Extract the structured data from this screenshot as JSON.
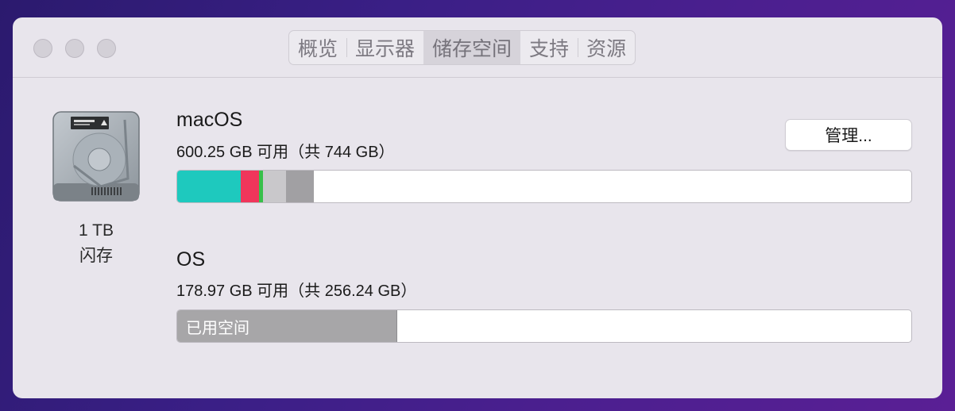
{
  "tabs": [
    {
      "label": "概览",
      "active": false
    },
    {
      "label": "显示器",
      "active": false
    },
    {
      "label": "储存空间",
      "active": true
    },
    {
      "label": "支持",
      "active": false
    },
    {
      "label": "资源",
      "active": false
    }
  ],
  "disk": {
    "icon": "hard-drive-icon",
    "size": "1 TB",
    "type": "闪存"
  },
  "volumes": [
    {
      "name": "macOS",
      "info": "600.25 GB 可用（共 744 GB）",
      "used_fraction": 0.193,
      "segments": [
        {
          "color": "#1ec9be",
          "fraction": 0.087
        },
        {
          "color": "#f0365b",
          "fraction": 0.024
        },
        {
          "color": "#37c04a",
          "fraction": 0.006
        },
        {
          "color": "#c9c8cb",
          "fraction": 0.031
        },
        {
          "color": "#a1a0a3",
          "fraction": 0.038
        }
      ]
    },
    {
      "name": "OS",
      "info": "178.97 GB 可用（共 256.24 GB）",
      "used_label": "已用空间",
      "used_fraction": 0.3,
      "used_color": "#a7a6a8"
    }
  ],
  "manage_button": {
    "label": "管理..."
  }
}
